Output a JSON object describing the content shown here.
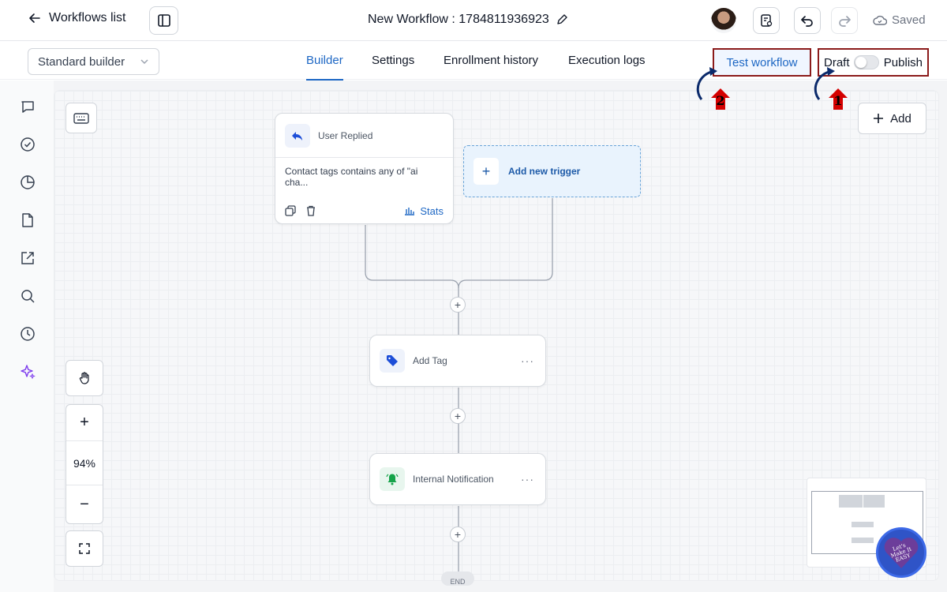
{
  "header": {
    "back_label": "Workflows list",
    "workflow_title": "New Workflow : 1784811936923",
    "saved_label": "Saved"
  },
  "subbar": {
    "builder_mode": "Standard builder",
    "tabs": [
      {
        "label": "Builder",
        "active": true
      },
      {
        "label": "Settings",
        "active": false
      },
      {
        "label": "Enrollment history",
        "active": false
      },
      {
        "label": "Execution logs",
        "active": false
      }
    ],
    "test_workflow_label": "Test workflow",
    "draft_label": "Draft",
    "publish_label": "Publish",
    "published": false
  },
  "sidebar": {
    "icons": [
      "chat-icon",
      "check-circle-icon",
      "pie-chart-icon",
      "file-icon",
      "external-link-icon",
      "search-icon",
      "clock-icon",
      "sparkle-icon"
    ]
  },
  "canvas": {
    "add_label": "Add",
    "zoom": "94%",
    "trigger": {
      "title": "User Replied",
      "condition": "Contact tags contains any of \"ai cha...",
      "stats_label": "Stats"
    },
    "new_trigger_label": "Add new trigger",
    "actions": [
      {
        "title": "Add Tag",
        "icon": "tag-icon"
      },
      {
        "title": "Internal Notification",
        "icon": "bell-icon"
      }
    ],
    "end_label": "END"
  },
  "annotations": [
    "2",
    "1"
  ],
  "badge_text": "Let's Make It EASY",
  "colors": {
    "accent": "#1d67c4",
    "highlight_border": "#8b1a1a",
    "annotation_red": "#d40000",
    "annotation_arrow": "#0b2a6b"
  }
}
